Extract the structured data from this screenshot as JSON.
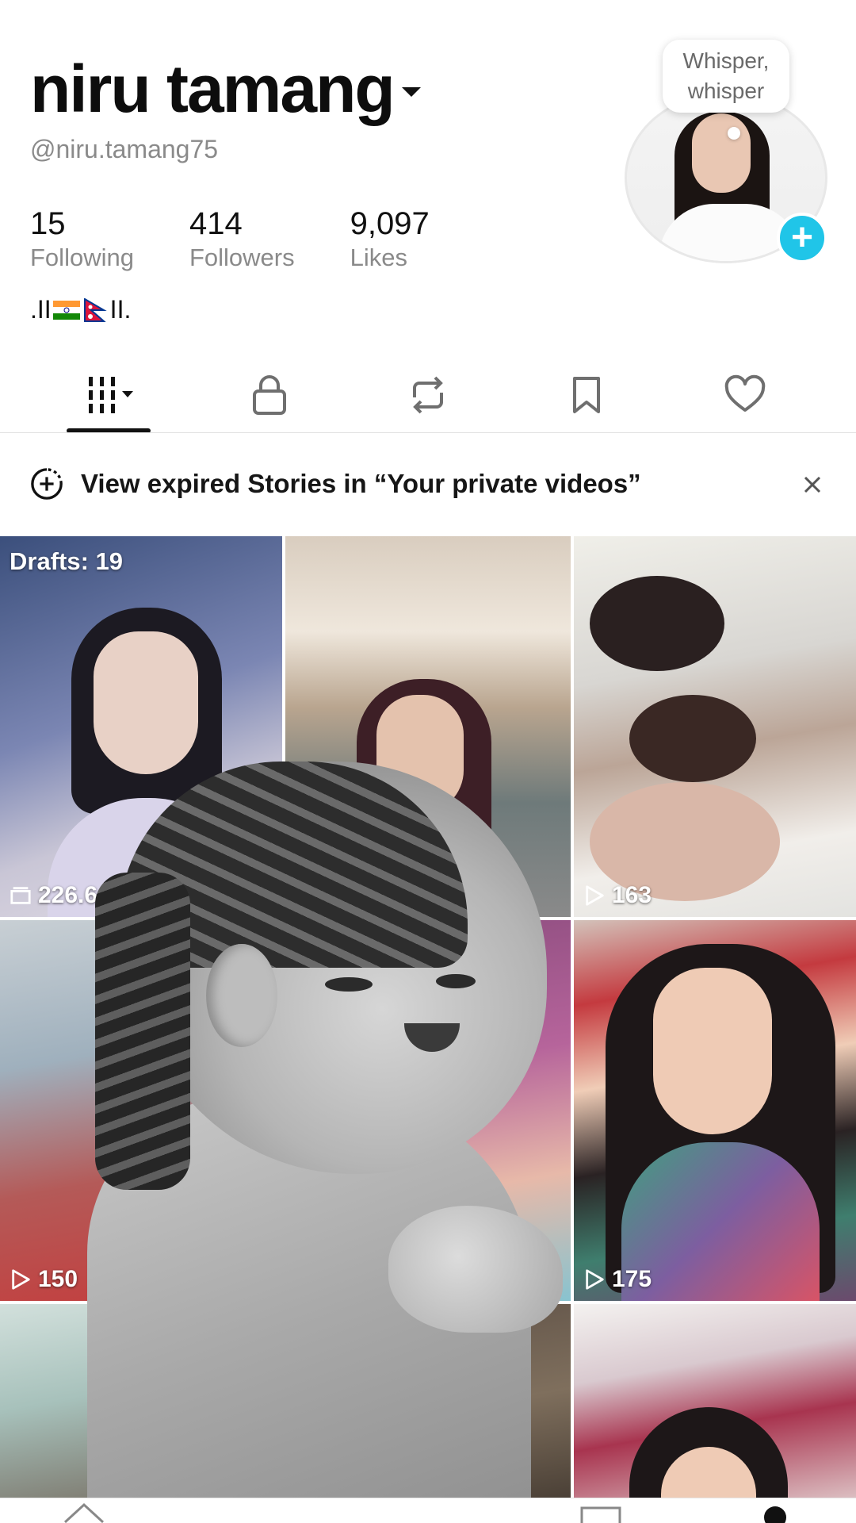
{
  "profile": {
    "name": "niru tamang",
    "handle": "@niru.tamang75",
    "bio_prefix": ".II",
    "bio_suffix": "II.",
    "bio_flags": [
      "india-flag-icon",
      "nepal-flag-icon"
    ],
    "avatar_bubble_line1": "Whisper,",
    "avatar_bubble_line2": "whisper"
  },
  "stats": [
    {
      "value": "15",
      "label": "Following"
    },
    {
      "value": "414",
      "label": "Followers"
    },
    {
      "value": "9,097",
      "label": "Likes"
    }
  ],
  "tabs": [
    {
      "name": "videos-grid-icon",
      "active": true
    },
    {
      "name": "lock-icon",
      "active": false
    },
    {
      "name": "repost-icon",
      "active": false
    },
    {
      "name": "bookmark-icon",
      "active": false
    },
    {
      "name": "heart-icon",
      "active": false
    }
  ],
  "notice": {
    "text": "View expired Stories in “Your private videos”"
  },
  "grid": {
    "drafts_label": "Drafts: 19",
    "tiles": [
      {
        "label": "226.6",
        "icon": "archive-icon"
      },
      {
        "label": "",
        "icon": ""
      },
      {
        "label": "163",
        "icon": "play-icon"
      },
      {
        "label": "150",
        "icon": "play-icon"
      },
      {
        "label": "",
        "icon": ""
      },
      {
        "label": "175",
        "icon": "play-icon"
      },
      {
        "label": "",
        "icon": ""
      },
      {
        "label": "",
        "icon": ""
      },
      {
        "label": "",
        "icon": ""
      }
    ]
  },
  "colors": {
    "accent": "#20c5e8",
    "text_primary": "#111111",
    "text_secondary": "#8a8a8a"
  }
}
